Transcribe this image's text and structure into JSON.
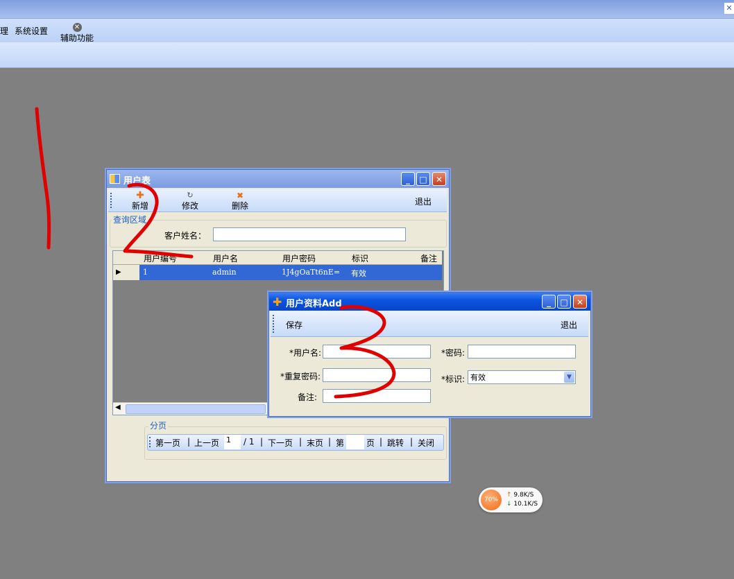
{
  "main_menu": {
    "items": [
      "理",
      "系统设置",
      "辅助功能"
    ]
  },
  "user_table_window": {
    "title": "用户表",
    "toolbar": {
      "add": "新增",
      "edit": "修改",
      "delete": "删除",
      "exit": "退出"
    },
    "query_group": "查询区域",
    "customer_name_label": "客户姓名：",
    "customer_name_value": "",
    "grid": {
      "columns": [
        "用户编号",
        "用户名",
        "用户密码",
        "标识",
        "备注"
      ],
      "rows": [
        {
          "id": "1",
          "username": "admin",
          "password": "1J4gOaTt6nE=",
          "status": "有效",
          "remark": ""
        }
      ]
    },
    "paging_group": "分页",
    "pager": {
      "first": "第一页",
      "prev": "上一页",
      "current_page": "1",
      "total": "/ 1",
      "next": "下一页",
      "last": "末页",
      "page_prefix": "第",
      "page_input": "",
      "page_suffix": "页",
      "jump": "跳转",
      "close": "关闭"
    }
  },
  "add_user_window": {
    "title": "用户资料Add",
    "toolbar": {
      "save": "保存",
      "exit": "退出"
    },
    "fields": {
      "username_label": "*用户名:",
      "username_value": "",
      "password_label": "*密码:",
      "password_value": "",
      "confirm_password_label": "*重复密码:",
      "confirm_password_value": "",
      "status_label": "*标识:",
      "status_value": "有效",
      "remark_label": "备注:",
      "remark_value": ""
    }
  },
  "network_widget": {
    "cpu": "70%",
    "upload": "9.8K/S",
    "download": "10.1K/S"
  },
  "annotation_color": "#e00000"
}
